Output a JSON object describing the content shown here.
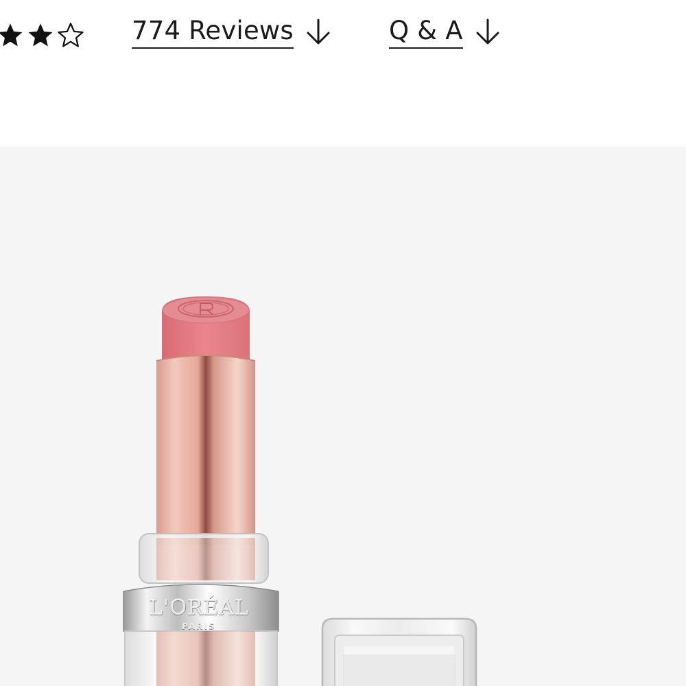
{
  "rating": {
    "stars": [
      {
        "icon": "star-filled-icon"
      },
      {
        "icon": "star-filled-icon"
      },
      {
        "icon": "star-outline-icon"
      }
    ],
    "filled_count": 2,
    "reviews_link": "774 Reviews",
    "qa_link": "Q & A",
    "arrow_icon": "arrow-down-icon",
    "text_color": "#1a1a1a"
  },
  "gallery": {
    "background": "#f5f5f5",
    "product_image": {
      "subject": "lipstick-with-cap",
      "bullet_color": "#e07f86",
      "tube_color": "#e9b3a5",
      "logo_text": "L'ORÉAL",
      "logo_subtext": "PARIS"
    }
  }
}
